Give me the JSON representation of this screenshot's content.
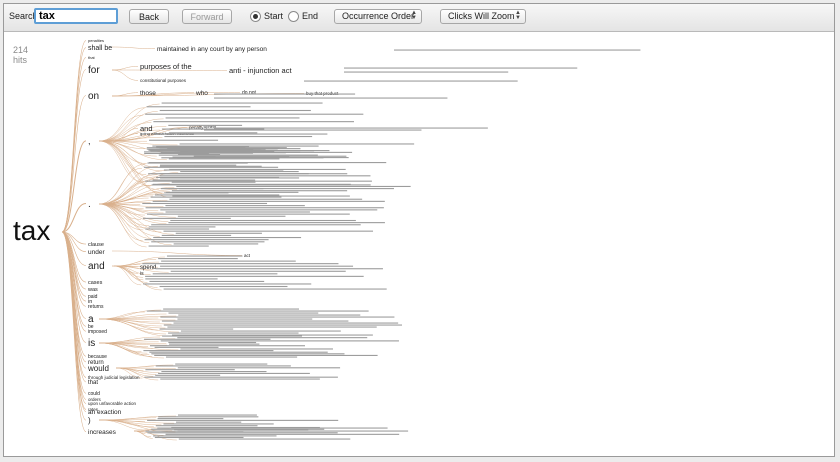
{
  "toolbar": {
    "search_label": "Search",
    "search_value": "tax",
    "back_label": "Back",
    "forward_label": "Forward",
    "radio_start_label": "Start",
    "radio_end_label": "End",
    "selected_radio": "Start",
    "order_select_value": "Occurrence Order",
    "zoom_select_value": "Clicks Will Zoom"
  },
  "tree": {
    "hits_count": "214",
    "hits_label": "hits",
    "root": "tax",
    "branch_color": "#d9b08c",
    "first_level": [
      {
        "label": "penalties"
      },
      {
        "label": "shall be"
      },
      {
        "label": "that"
      },
      {
        "label": "for"
      },
      {
        "label": "on"
      },
      {
        "label": ","
      },
      {
        "label": "."
      },
      {
        "label": "clause"
      },
      {
        "label": "under"
      },
      {
        "label": "and"
      },
      {
        "label": "cases"
      },
      {
        "label": "was"
      },
      {
        "label": "paid"
      },
      {
        "label": "in"
      },
      {
        "label": "returns"
      },
      {
        "label": "a"
      },
      {
        "label": "be"
      },
      {
        "label": "imposed"
      },
      {
        "label": "is"
      },
      {
        "label": "because"
      },
      {
        "label": "return"
      },
      {
        "label": "would"
      },
      {
        "label": "through judicial legislation"
      },
      {
        "label": "that"
      },
      {
        "label": "could"
      },
      {
        "label": "orders"
      },
      {
        "label": "upon unfavorable action"
      },
      {
        "label": "rates"
      },
      {
        "label": "an exaction"
      },
      {
        "label": ")"
      },
      {
        "label": "increases"
      }
    ],
    "phrases": [
      {
        "label": "maintained in any court by any person"
      },
      {
        "label": "purposes of the"
      },
      {
        "label": "anti - injunction act"
      },
      {
        "label": "constitutional purposes"
      },
      {
        "label": "those"
      },
      {
        "label": "who"
      },
      {
        "label": "do not"
      },
      {
        "label": "buy that product"
      },
      {
        "label": "going without health insurance"
      },
      {
        "label": "and"
      },
      {
        "label": "penalty"
      },
      {
        "label": "spend"
      },
      {
        "label": "is"
      },
      {
        "label": "act"
      },
      {
        "label": "upheld"
      }
    ]
  }
}
